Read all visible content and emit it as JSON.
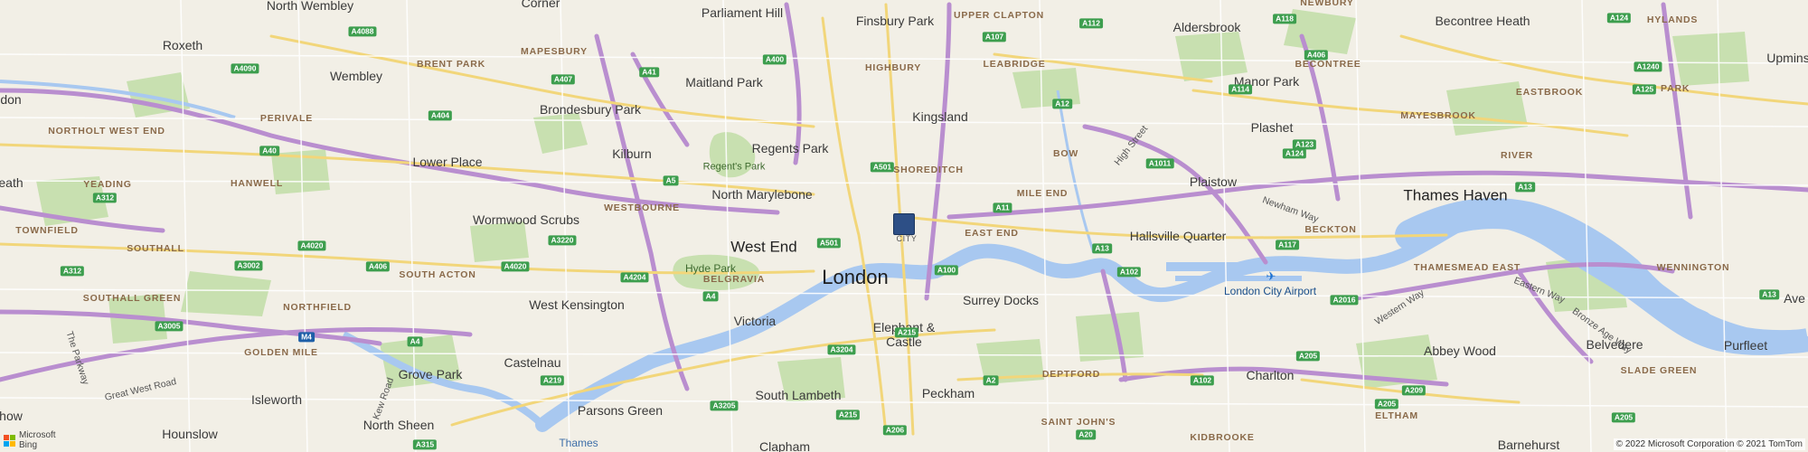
{
  "map": {
    "copyright": "© 2022 Microsoft Corporation © 2021 TomTom",
    "attribution": {
      "line1": "Microsoft",
      "line2": "Bing"
    },
    "pin": {
      "label": "CITY"
    },
    "colors": {
      "water": "#a8c8f0",
      "park": "#c8e0b0",
      "motorway": "#b98ecf",
      "primary": "#f2d67a",
      "background": "#f2efe6",
      "pin": "#2d4f86"
    },
    "labels": {
      "north_wembley": "North Wembley",
      "corner": "Corner",
      "parliament_hill": "Parliament Hill",
      "finsbury_park": "Finsbury Park",
      "upper_clapton": "UPPER CLAPTON",
      "aldersbrook": "Aldersbrook",
      "newbury": "NEWBURY",
      "becontree_heath": "Becontree Heath",
      "hylands": "HYLANDS",
      "upmins": "Upmins",
      "roxeth": "Roxeth",
      "mapesbury": "MAPESBURY",
      "highbury": "HIGHBURY",
      "leabridge": "LEABRIDGE",
      "becontree": "BECONTREE",
      "elm_park": "ELM PARK",
      "wembley": "Wembley",
      "brent_park": "BRENT PARK",
      "maitland_park": "Maitland Park",
      "manor_park": "Manor Park",
      "eastbrook": "EASTBROOK",
      "don": "don",
      "brondesbury_park": "Brondesbury Park",
      "kingsland": "Kingsland",
      "plashet": "Plashet",
      "perivale": "PERIVALE",
      "mayesbrook": "MAYESBROOK",
      "northolt_west_end": "NORTHOLT WEST END",
      "kilburn": "Kilburn",
      "regents_park": "Regents Park",
      "bow": "BOW",
      "lower_place": "Lower Place",
      "river": "RIVER",
      "regents_park_green": "Regent's Park",
      "shoreditch": "SHOREDITCH",
      "eath": "eath",
      "yeading": "YEADING",
      "north_marylebone": "North Marylebone",
      "mile_end": "MILE END",
      "plaistow": "Plaistow",
      "thames_haven": "Thames Haven",
      "hanwell": "HANWELL",
      "westbourne": "WESTBOURNE",
      "wormwood_scrubs": "Wormwood Scrubs",
      "townfield": "TOWNFIELD",
      "west_end": "West End",
      "east_end": "EAST END",
      "hallsville_quarter": "Hallsville Quarter",
      "beckton": "BECKTON",
      "southall": "SOUTHALL",
      "hyde_park": "Hyde Park",
      "wennington": "WENNINGTON",
      "london": "London",
      "belgravia": "BELGRAVIA",
      "south_acton": "SOUTH ACTON",
      "london_city_airport": "London City Airport",
      "thamesmead_east": "THAMESMEAD EAST",
      "southall_green": "SOUTHALL GREEN",
      "surrey_docks": "Surrey Docks",
      "ave": "Ave",
      "west_kensington": "West Kensington",
      "northfield": "NORTHFIELD",
      "victoria": "Victoria",
      "elephant_castle_1": "Elephant &",
      "elephant_castle_2": "Castle",
      "golden_mile": "GOLDEN MILE",
      "abbey_wood": "Abbey Wood",
      "belvedere": "Belvedere",
      "purfleet": "Purfleet",
      "castelnau": "Castelnau",
      "grove_park": "Grove Park",
      "deptford": "DEPTFORD",
      "charlton": "Charlton",
      "slade_green": "SLADE GREEN",
      "isleworth": "Isleworth",
      "south_lambeth": "South Lambeth",
      "peckham": "Peckham",
      "parsons_green": "Parsons Green",
      "elthan": "ELTHAM",
      "north_sheen": "North Sheen",
      "hounslow": "Hounslow",
      "saint_johns": "SAINT JOHN'S",
      "kidbrooke": "KIDBROOKE",
      "barnehurst": "Barnehurst",
      "thames": "Thames",
      "clapham": "Clapham",
      "how": "how"
    },
    "road_names": {
      "high_street": "High Street",
      "newham_way": "Newham Way",
      "western_way": "Western Way",
      "eastern_way": "Eastern Way",
      "bronze_age_way": "Bronze Age Way",
      "great_west_road": "Great West Road",
      "kew_road": "Kew Road",
      "the_parkway": "The Parkway"
    },
    "shields": [
      "A4088",
      "A112",
      "A118",
      "A124",
      "A406",
      "A400",
      "A107",
      "A41",
      "A4090",
      "A407",
      "A12",
      "A114",
      "A1240",
      "A404",
      "A125",
      "A40",
      "A501",
      "A1011",
      "A124",
      "A5",
      "A11",
      "A123",
      "A312",
      "A13",
      "A4020",
      "A3220",
      "A501",
      "A13",
      "A117",
      "A3002",
      "A406",
      "A4020",
      "A100",
      "A102",
      "A2016",
      "A312",
      "A4204",
      "A4",
      "A13",
      "A3005",
      "M4",
      "A4",
      "A3204",
      "A215",
      "A205",
      "A2",
      "A102",
      "A209",
      "A219",
      "A3205",
      "A215",
      "A20",
      "A206",
      "A315",
      "A205",
      "A205"
    ]
  }
}
